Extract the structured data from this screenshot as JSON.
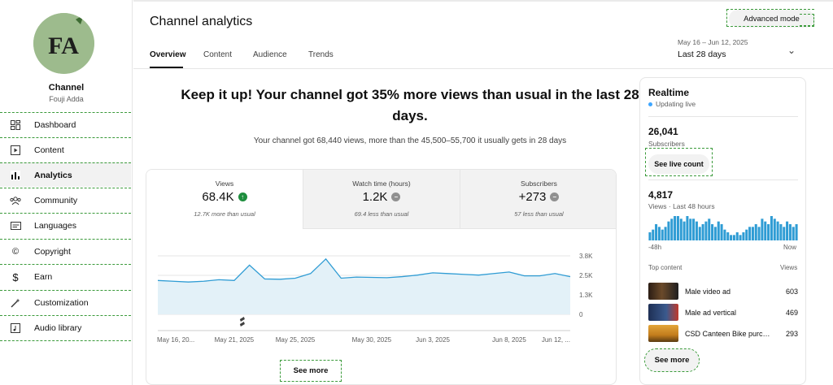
{
  "sidebar": {
    "channel_title": "Channel",
    "channel_name": "Fouji Adda",
    "avatar_text": "FA",
    "items": [
      {
        "label": "Dashboard",
        "icon": "dashboard-icon"
      },
      {
        "label": "Content",
        "icon": "content-icon"
      },
      {
        "label": "Analytics",
        "icon": "analytics-icon"
      },
      {
        "label": "Community",
        "icon": "community-icon"
      },
      {
        "label": "Languages",
        "icon": "languages-icon"
      },
      {
        "label": "Copyright",
        "icon": "copyright-icon"
      },
      {
        "label": "Earn",
        "icon": "earn-icon"
      },
      {
        "label": "Customization",
        "icon": "customization-icon"
      },
      {
        "label": "Audio library",
        "icon": "audio-library-icon"
      }
    ]
  },
  "header": {
    "title": "Channel analytics",
    "tabs": [
      "Overview",
      "Content",
      "Audience",
      "Trends"
    ],
    "advanced_mode": "Advanced mode",
    "date_range": "May 16 – Jun 12, 2025",
    "period": "Last 28 days"
  },
  "summary": {
    "headline": "Keep it up! Your channel got 35% more views than usual in the last 28 days.",
    "subline": "Your channel got 68,440 views, more than the 45,500–55,700 it usually gets in 28 days"
  },
  "metrics": [
    {
      "label": "Views",
      "value": "68.4K",
      "note": "12.7K more than usual",
      "trend": "up",
      "color": "#1e8e3e"
    },
    {
      "label": "Watch time (hours)",
      "value": "1.2K",
      "note": "69.4 less than usual",
      "trend": "neutral",
      "color": "#909090"
    },
    {
      "label": "Subscribers",
      "value": "+273",
      "note": "57 less than usual",
      "trend": "neutral",
      "color": "#909090"
    }
  ],
  "chart_data": {
    "type": "area",
    "x": [
      "May 16",
      "May 17",
      "May 18",
      "May 19",
      "May 20",
      "May 21",
      "May 22",
      "May 23",
      "May 24",
      "May 25",
      "May 26",
      "May 27",
      "May 28",
      "May 29",
      "May 30",
      "May 31",
      "Jun 1",
      "Jun 2",
      "Jun 3",
      "Jun 4",
      "Jun 5",
      "Jun 6",
      "Jun 7",
      "Jun 8",
      "Jun 9",
      "Jun 10",
      "Jun 11",
      "Jun 12"
    ],
    "values": [
      2200,
      2150,
      2100,
      2150,
      2250,
      2200,
      3200,
      2300,
      2280,
      2350,
      2650,
      3600,
      2350,
      2420,
      2400,
      2380,
      2450,
      2550,
      2700,
      2650,
      2600,
      2550,
      2650,
      2750,
      2500,
      2500,
      2650,
      2450
    ],
    "x_tick_labels": [
      "May 16, 20...",
      "May 21, 2025",
      "May 25, 2025",
      "May 30, 2025",
      "Jun 3, 2025",
      "Jun 8, 2025",
      "Jun 12, ..."
    ],
    "y_tick_labels": [
      "3.8K",
      "2.5K",
      "1.3K",
      "0"
    ],
    "ylim": [
      0,
      3800
    ],
    "grid": true,
    "line_color": "#2f9cd4",
    "fill_color": "#e3f1f8",
    "annotation_icon": "shorts-icon"
  },
  "see_more": "See more",
  "realtime": {
    "title": "Realtime",
    "status": "Updating live",
    "subscribers": "26,041",
    "subscribers_label": "Subscribers",
    "live_button": "See live count",
    "views": "4,817",
    "views_label": "Views · Last 48 hours",
    "axis_left": "-48h",
    "axis_right": "Now",
    "bars": [
      3,
      4,
      6,
      5,
      4,
      5,
      7,
      8,
      9,
      9,
      8,
      7,
      9,
      8,
      8,
      7,
      5,
      6,
      7,
      8,
      6,
      5,
      7,
      6,
      4,
      3,
      2,
      2,
      3,
      2,
      3,
      4,
      5,
      5,
      6,
      5,
      8,
      7,
      6,
      9,
      8,
      7,
      6,
      5,
      7,
      6,
      5,
      6
    ],
    "bar_color": "#2f9cd4",
    "top_content_label": "Top content",
    "top_content_views_label": "Views",
    "top_content": [
      {
        "title": "Male video ad",
        "views": "603",
        "color": "#3a2a20"
      },
      {
        "title": "Male ad vertical",
        "views": "469",
        "color": "#263a6a"
      },
      {
        "title": "CSD Canteen Bike purchas...",
        "views": "293",
        "color": "#c78a22"
      }
    ],
    "see_more": "See more"
  }
}
